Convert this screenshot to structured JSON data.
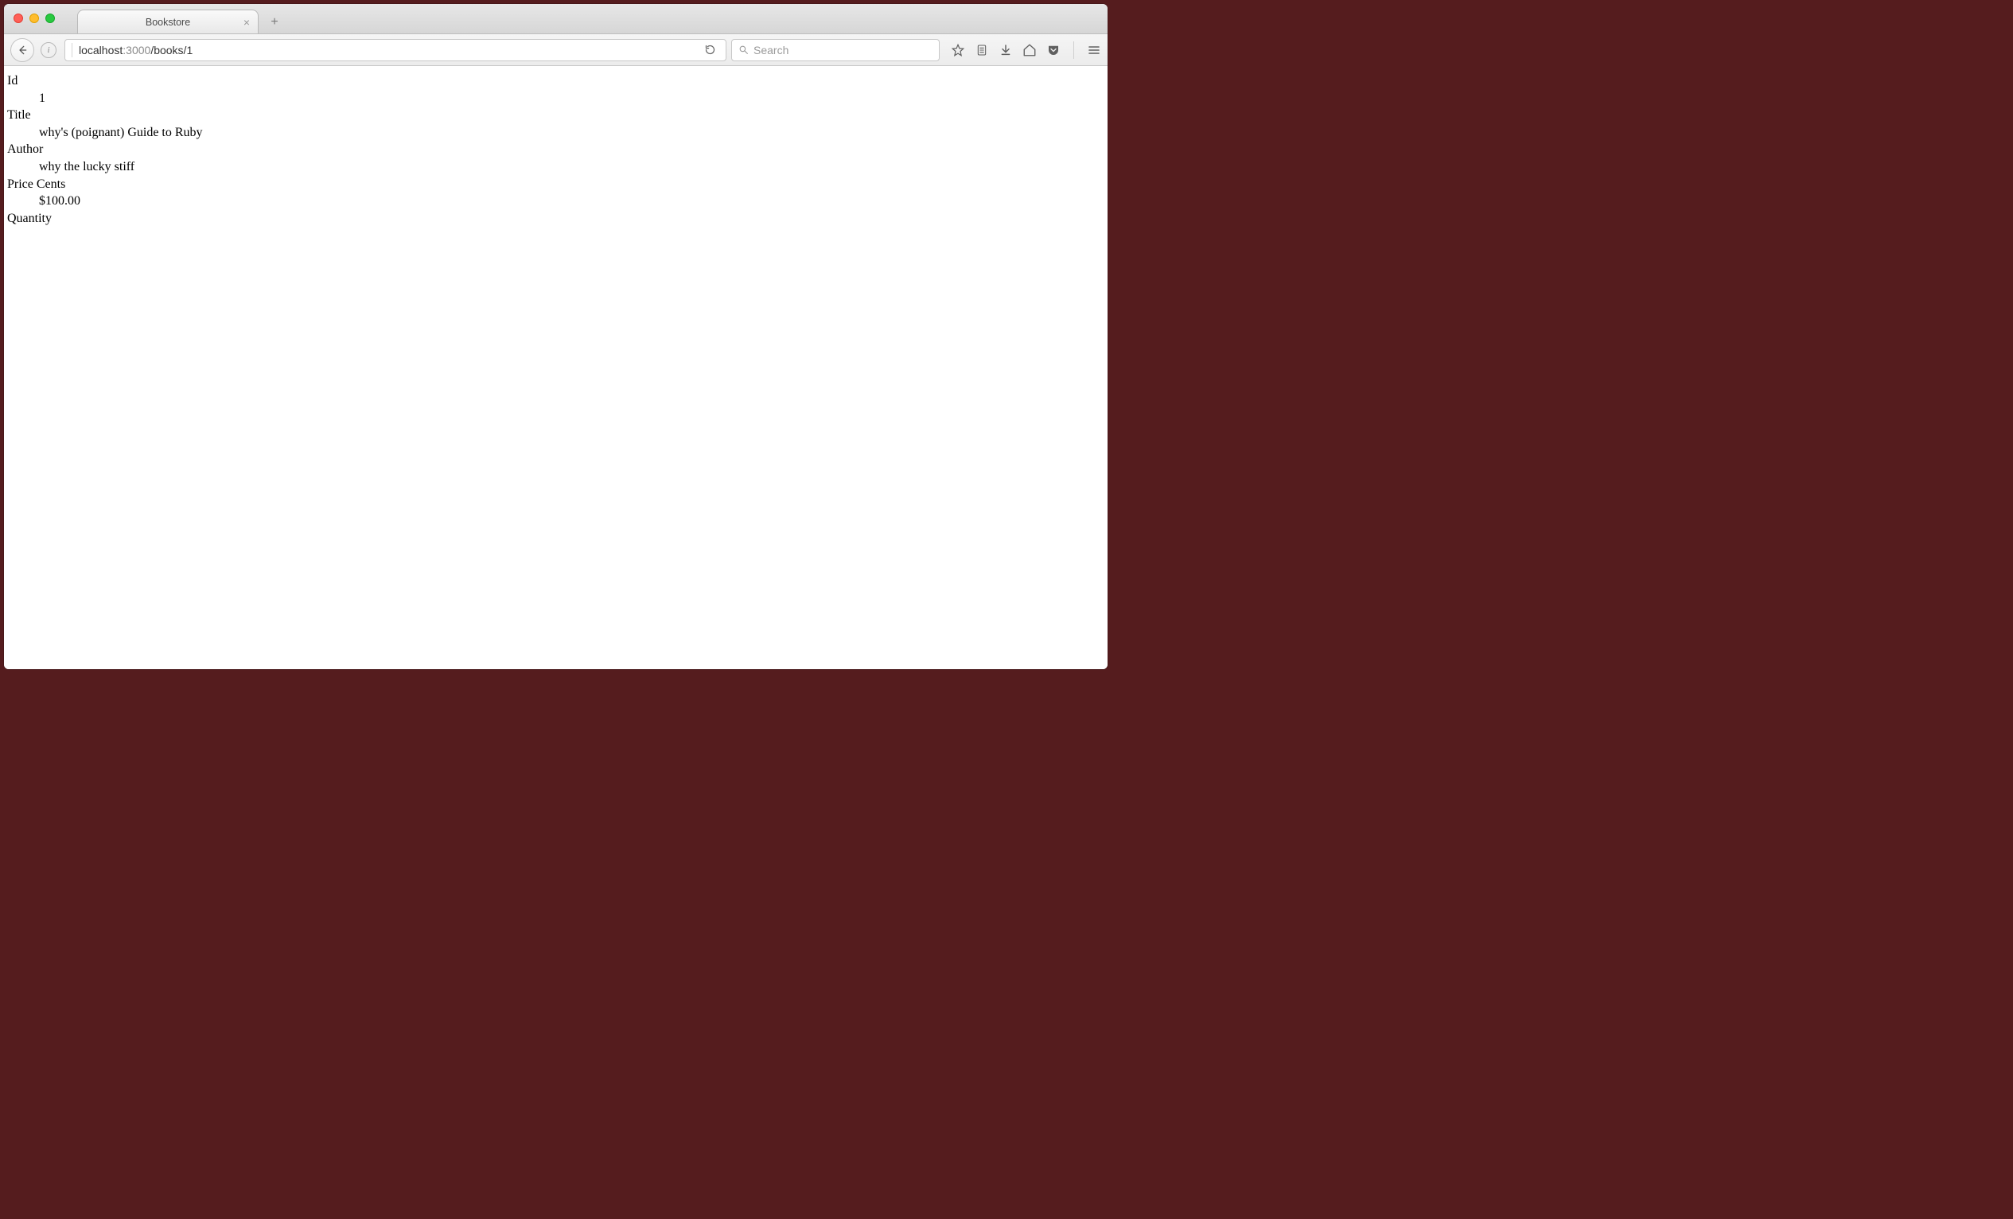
{
  "window": {
    "tab_title": "Bookstore"
  },
  "toolbar": {
    "url": {
      "host": "localhost",
      "port": ":3000",
      "path": "/books/1"
    },
    "search_placeholder": "Search"
  },
  "page": {
    "fields": {
      "id": {
        "label": "Id",
        "value": "1"
      },
      "title": {
        "label": "Title",
        "value": "why's (poignant) Guide to Ruby"
      },
      "author": {
        "label": "Author",
        "value": "why the lucky stiff"
      },
      "price_cents": {
        "label": "Price Cents",
        "value": "$100.00"
      },
      "quantity": {
        "label": "Quantity",
        "value": ""
      }
    }
  }
}
